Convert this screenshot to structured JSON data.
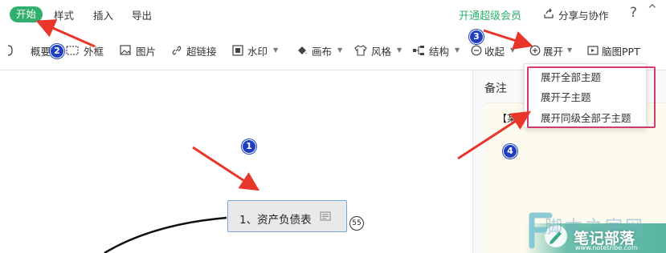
{
  "menu": {
    "tabs": [
      "开始",
      "样式",
      "插入",
      "导出"
    ],
    "vip": "开通超级会员",
    "share": "分享与协作",
    "help": "?",
    "collapse": "^"
  },
  "toolbar": {
    "summary": "概要",
    "frame": "外框",
    "image": "图片",
    "hyperlink": "超链接",
    "watermark": "水印",
    "canvas": "画布",
    "style": "风格",
    "structure": "结构",
    "collapse": "收起",
    "expand": "展开",
    "mindmap_ppt": "脑图PPT"
  },
  "dropdown": {
    "items": [
      "展开全部主题",
      "展开子主题",
      "展开同级全部子主题"
    ]
  },
  "notes": {
    "title": "备注",
    "text": "【某I"
  },
  "node": {
    "label": "1、资产负债表",
    "count": "55"
  },
  "annotations": {
    "badges": [
      "1",
      "2",
      "3",
      "4"
    ],
    "arrow_color": "#e8362b",
    "badge_color": "#1f3fbf"
  },
  "watermark": {
    "top": "脚本之家网",
    "main": "笔记部落",
    "url": "www.notetribe.com"
  },
  "colors": {
    "accent": "#2fb16d",
    "highlight_border": "#d43a6a"
  }
}
